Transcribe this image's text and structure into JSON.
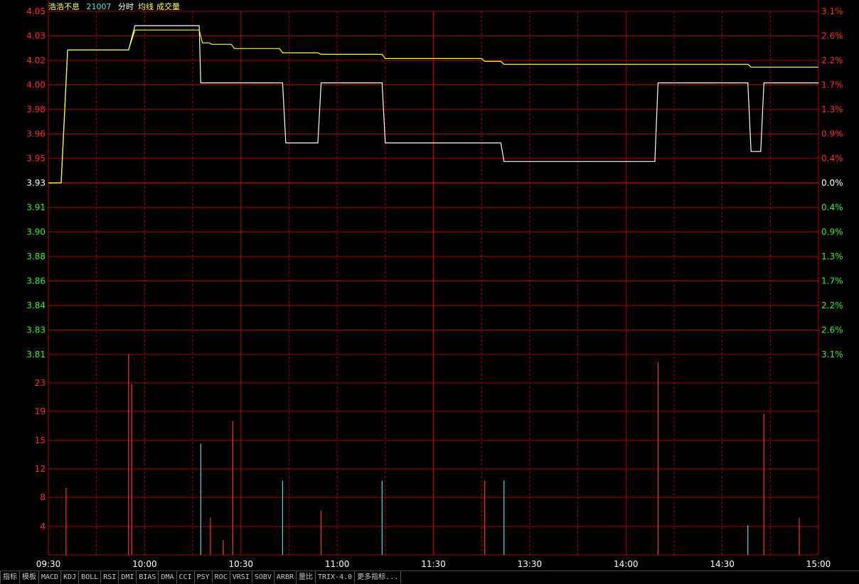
{
  "header": {
    "stock_name": "浩浩不息",
    "stock_code": "21007",
    "labels": [
      "分时",
      "均线",
      "成交量"
    ]
  },
  "colors": {
    "background": "#000000",
    "grid": "#b00000",
    "up": "#ff2a2a",
    "down": "#33ee33",
    "price_line": "#ffffff",
    "avg_line": "#ffff00",
    "vol_up": "#ff3333",
    "vol_down": "#44dddd",
    "header_name": "#ffff66",
    "header_code": "#66dddd"
  },
  "chart_data": {
    "type": "line",
    "title": "",
    "prev_close": 3.93,
    "price_axis_labels": [
      "4.05",
      "4.03",
      "4.02",
      "4.00",
      "3.98",
      "3.96",
      "3.95",
      "3.93",
      "3.91",
      "3.90",
      "3.88",
      "3.86",
      "3.84",
      "3.83",
      "3.81"
    ],
    "pct_axis_labels": [
      "3.1%",
      "2.6%",
      "2.2%",
      "1.7%",
      "1.3%",
      "0.9%",
      "0.4%",
      "0.0%",
      "0.4%",
      "0.9%",
      "1.3%",
      "1.7%",
      "2.2%",
      "2.6%",
      "3.1%"
    ],
    "volume_axis_labels": [
      "23",
      "19",
      "15",
      "12",
      "8",
      "4"
    ],
    "time_labels": [
      "09:30",
      "10:00",
      "10:30",
      "11:00",
      "11:30",
      "13:30",
      "14:00",
      "14:30",
      "15:00"
    ],
    "ylim": [
      3.81,
      4.05
    ],
    "volume_ylim": [
      0,
      27
    ],
    "x_range_minutes": [
      0,
      240
    ],
    "series": [
      {
        "key": "price",
        "points": [
          [
            0,
            3.93
          ],
          [
            4,
            3.93
          ],
          [
            6,
            4.023
          ],
          [
            25,
            4.023
          ],
          [
            27,
            4.04
          ],
          [
            47,
            4.04
          ],
          [
            47.5,
            4.0
          ],
          [
            73,
            4.0
          ],
          [
            74,
            3.958
          ],
          [
            84,
            3.958
          ],
          [
            85,
            4.0
          ],
          [
            104,
            4.0
          ],
          [
            105,
            3.958
          ],
          [
            141,
            3.958
          ],
          [
            142,
            3.945
          ],
          [
            189,
            3.945
          ],
          [
            190,
            4.0
          ],
          [
            218,
            4.0
          ],
          [
            219,
            3.952
          ],
          [
            222,
            3.952
          ],
          [
            223,
            4.0
          ],
          [
            240,
            4.0
          ]
        ]
      },
      {
        "key": "avg",
        "points": [
          [
            0,
            3.93
          ],
          [
            4,
            3.93
          ],
          [
            6,
            4.023
          ],
          [
            25,
            4.023
          ],
          [
            27,
            4.037
          ],
          [
            47,
            4.037
          ],
          [
            48,
            4.028
          ],
          [
            50,
            4.028
          ],
          [
            51,
            4.027
          ],
          [
            57,
            4.027
          ],
          [
            58,
            4.024
          ],
          [
            72,
            4.024
          ],
          [
            73,
            4.021
          ],
          [
            84,
            4.021
          ],
          [
            85,
            4.02
          ],
          [
            104,
            4.02
          ],
          [
            105,
            4.017
          ],
          [
            135,
            4.017
          ],
          [
            136,
            4.015
          ],
          [
            141,
            4.015
          ],
          [
            142,
            4.013
          ],
          [
            218,
            4.013
          ],
          [
            219,
            4.011
          ],
          [
            240,
            4.011
          ]
        ]
      }
    ],
    "volume": [
      {
        "t": 5.5,
        "v": 9,
        "dir": "up"
      },
      {
        "t": 25,
        "v": 27,
        "dir": "up"
      },
      {
        "t": 26,
        "v": 23,
        "dir": "up"
      },
      {
        "t": 47.5,
        "v": 15,
        "dir": "down"
      },
      {
        "t": 50.5,
        "v": 5,
        "dir": "up"
      },
      {
        "t": 54.5,
        "v": 2,
        "dir": "up"
      },
      {
        "t": 57.5,
        "v": 18,
        "dir": "up"
      },
      {
        "t": 73,
        "v": 10,
        "dir": "down"
      },
      {
        "t": 85,
        "v": 6,
        "dir": "up"
      },
      {
        "t": 104,
        "v": 10,
        "dir": "down"
      },
      {
        "t": 136,
        "v": 10,
        "dir": "up"
      },
      {
        "t": 142,
        "v": 10,
        "dir": "down"
      },
      {
        "t": 190,
        "v": 26,
        "dir": "up"
      },
      {
        "t": 218,
        "v": 4,
        "dir": "down"
      },
      {
        "t": 223,
        "v": 19,
        "dir": "up"
      },
      {
        "t": 234,
        "v": 5,
        "dir": "up"
      }
    ]
  },
  "tabs": [
    "指标",
    "模板",
    "MACD",
    "KDJ",
    "BOLL",
    "RSI",
    "DMI",
    "BIAS",
    "DMA",
    "CCI",
    "PSY",
    "ROC",
    "VRSI",
    "SOBV",
    "ARBR",
    "量比",
    "TRIX-4.0",
    "更多指标..."
  ]
}
